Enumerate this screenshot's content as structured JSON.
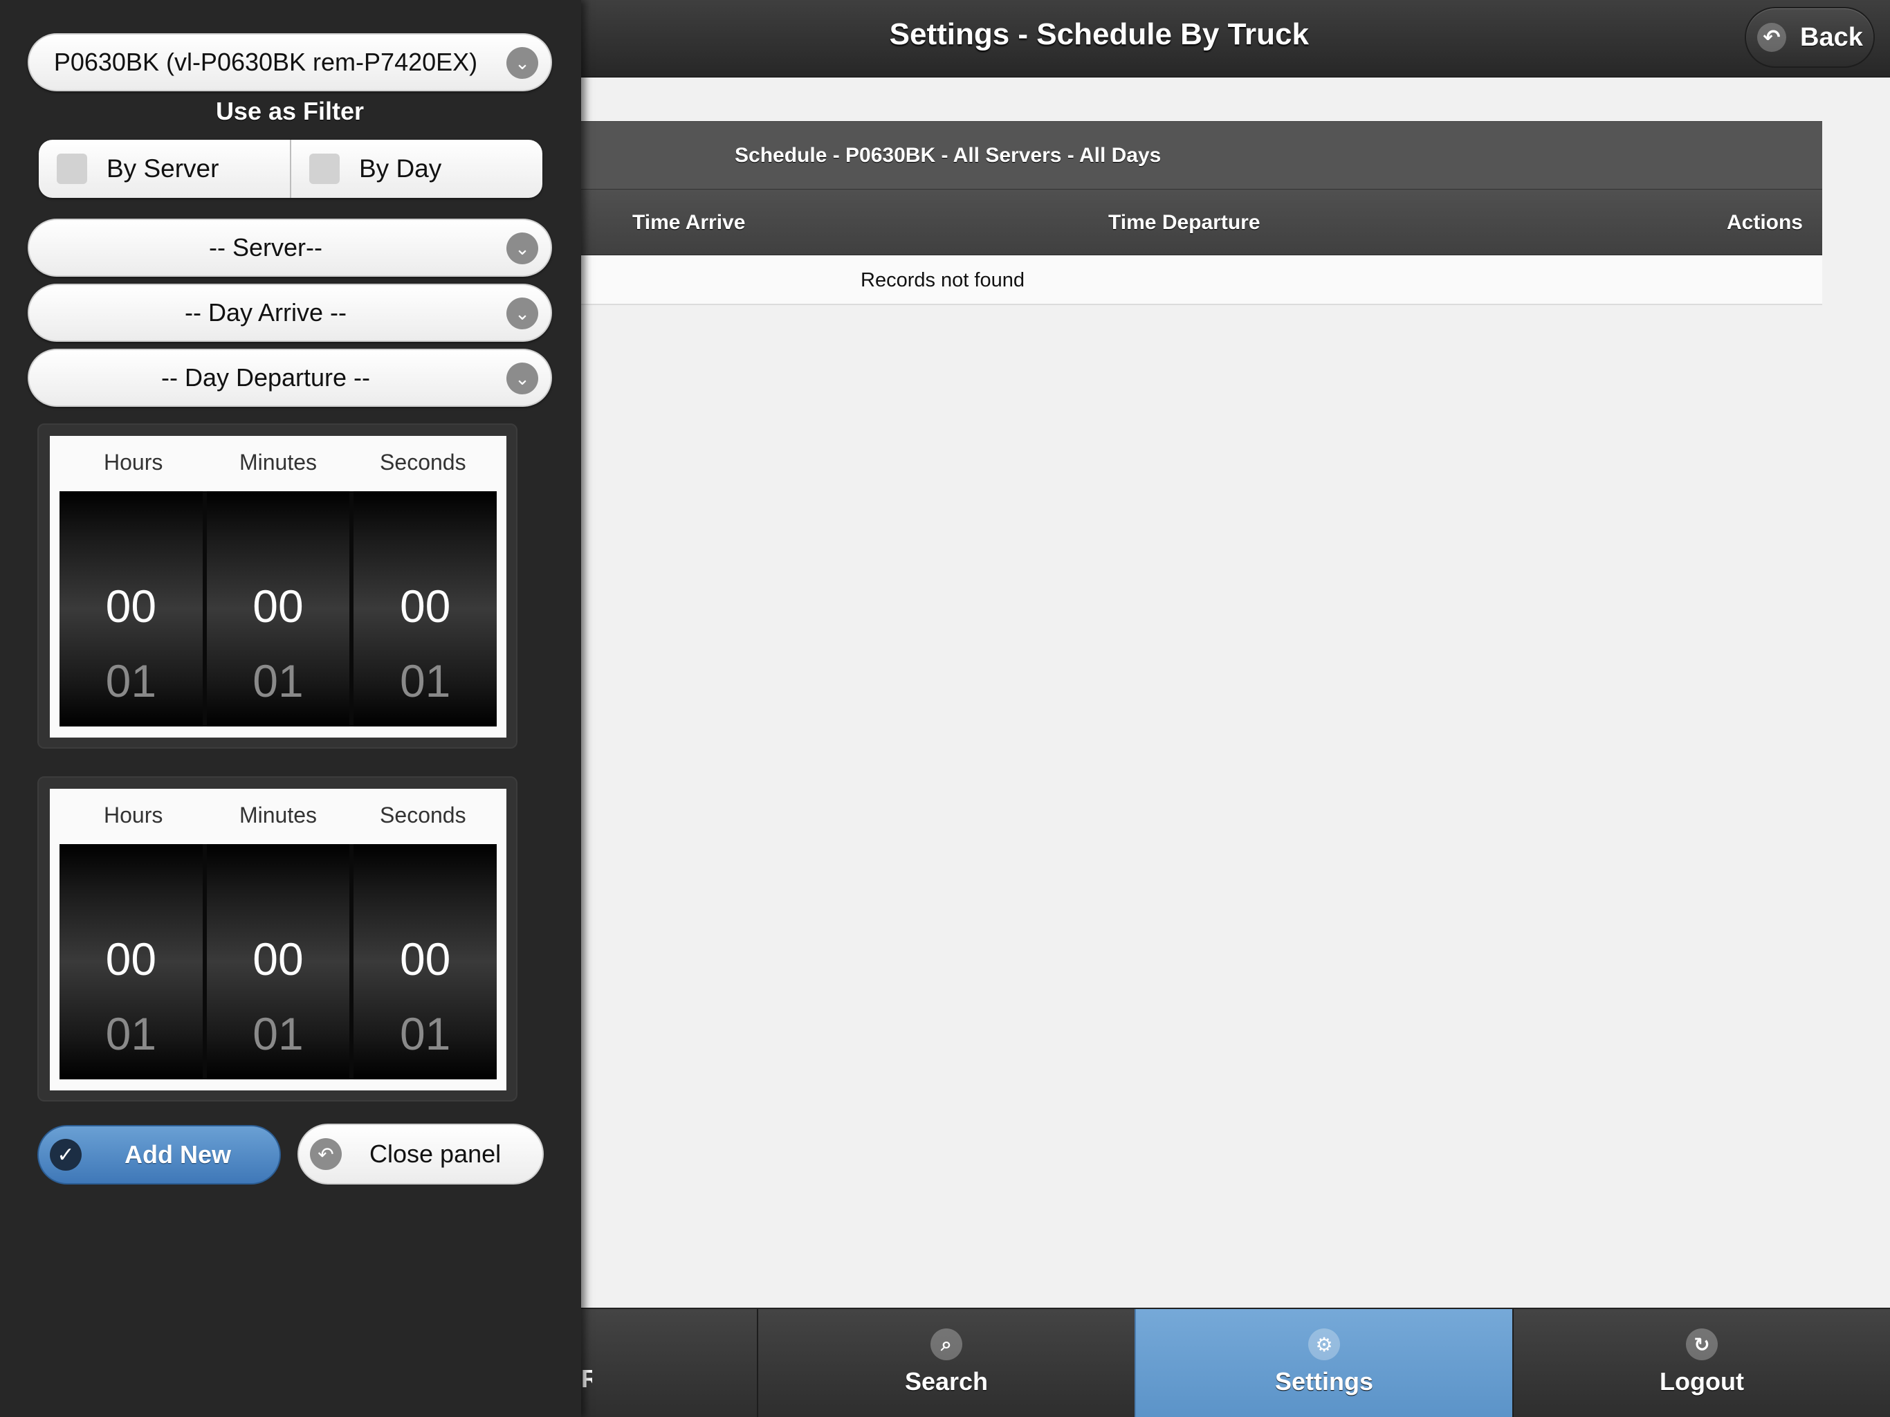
{
  "header": {
    "title": "Settings - Schedule By Truck",
    "back_label": "Back",
    "back_icon": "back-arrow-icon"
  },
  "panel": {
    "truck_select_value": "P0630BK (vl-P0630BK rem-P7420EX)",
    "filter_label": "Use as Filter",
    "filters": [
      {
        "label": "By Server",
        "checked": false
      },
      {
        "label": "By Day",
        "checked": false
      }
    ],
    "server_select_value": "-- Server--",
    "day_arrive_select_value": "-- Day Arrive --",
    "day_departure_select_value": "-- Day Departure --",
    "time_pickers": [
      {
        "labels": [
          "Hours",
          "Minutes",
          "Seconds"
        ],
        "current": [
          "00",
          "00",
          "00"
        ],
        "next": [
          "01",
          "01",
          "01"
        ]
      },
      {
        "labels": [
          "Hours",
          "Minutes",
          "Seconds"
        ],
        "current": [
          "00",
          "00",
          "00"
        ],
        "next": [
          "01",
          "01",
          "01"
        ]
      }
    ],
    "add_new_label": "Add New",
    "close_panel_label": "Close panel"
  },
  "table": {
    "caption": "Schedule  - P0630BK - All Servers - All Days",
    "columns": [
      "Time Arrive",
      "Time Departure",
      "Actions"
    ],
    "empty_message": "Records not found"
  },
  "nav": {
    "partial_label": "R",
    "items": [
      {
        "label": "Search",
        "icon": "search-icon",
        "active": false
      },
      {
        "label": "Settings",
        "icon": "gear-icon",
        "active": true
      },
      {
        "label": "Logout",
        "icon": "refresh-icon",
        "active": false
      }
    ]
  },
  "colors": {
    "active_nav": "#6aa0d4",
    "primary_button": "#4f88c4",
    "panel_bg": "#272727",
    "header_bg": "#303030"
  }
}
